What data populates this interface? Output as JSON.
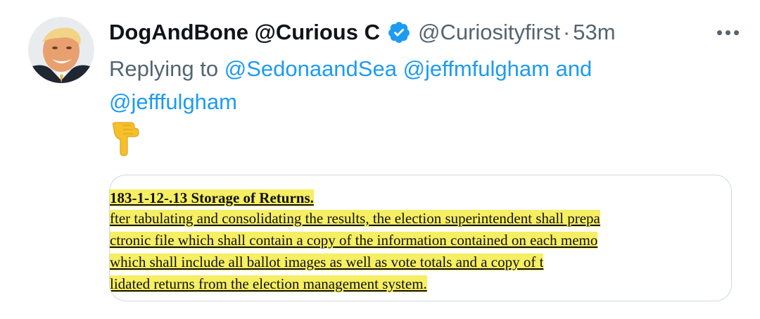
{
  "tweet": {
    "display_name": "DogAndBone @Curious C",
    "handle": "@Curiosityfirst",
    "separator": "·",
    "time": "53m",
    "reply_prefix": "Replying to",
    "mentions": [
      "@SedonaandSea",
      "@jeffmfulgham",
      "@jefffulgham"
    ],
    "mention_joiner": "and",
    "emoji": "👇",
    "verified_color": "#1d9bf0",
    "accent_color": "#1d9bf0"
  },
  "media": {
    "heading": "183-1-12-.13 Storage of Returns.",
    "lines": [
      "fter tabulating and consolidating the results, the election superintendent shall prepa",
      "ctronic file which shall contain a copy of the information contained on each memo",
      "which shall include all ballot images  as  well as vote totals and  a copy of t",
      "lidated returns from the election management system."
    ],
    "highlight_color": "#f6ee63"
  },
  "icons": {
    "avatar": "avatar-photo",
    "verified": "verified-badge-icon",
    "more": "more-options-icon",
    "emoji": "backhand-index-pointing-down-icon"
  }
}
